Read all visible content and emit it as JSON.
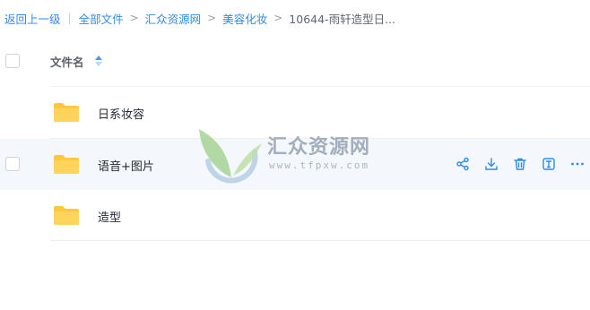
{
  "breadcrumb": {
    "back": "返回上一级",
    "separator": "|",
    "items": [
      "全部文件",
      "汇众资源网",
      "美容化妆"
    ],
    "arrow": ">",
    "current": "10644-雨轩造型日..."
  },
  "table": {
    "column_name": "文件名",
    "rows": [
      {
        "name": "日系妆容"
      },
      {
        "name": "语音+图片"
      },
      {
        "name": "造型"
      }
    ]
  },
  "row_actions": [
    "share-icon",
    "download-icon",
    "delete-icon",
    "rename-icon",
    "more-icon"
  ],
  "watermark": {
    "title": "汇众资源网",
    "url": "www.tfpxw.com"
  },
  "colors": {
    "link": "#2f8be6",
    "folder": "#ffc83d",
    "action_icon": "#2f8be6",
    "hover_row": "#f4f7fc"
  }
}
